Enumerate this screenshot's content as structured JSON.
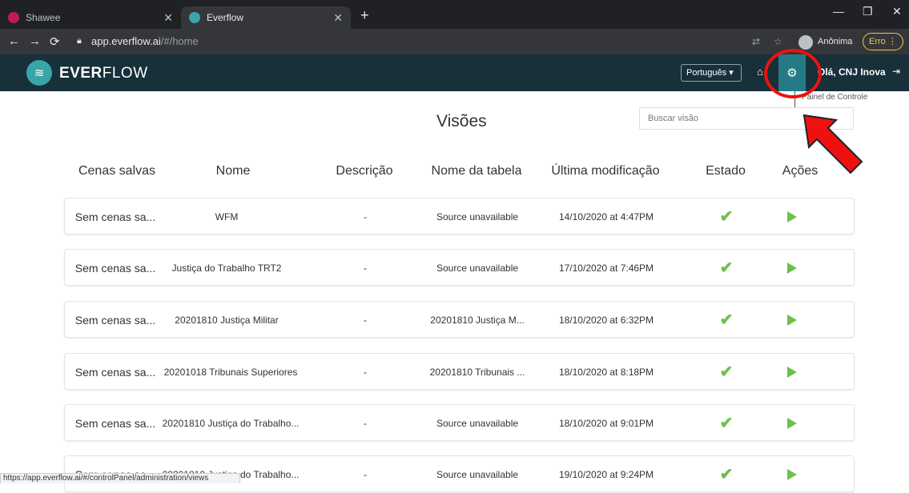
{
  "browser": {
    "tabs": [
      {
        "label": "Shawee",
        "favicon_color": "#c2185b"
      },
      {
        "label": "Everflow",
        "favicon_color": "#39a5a8"
      }
    ],
    "new_tab": "+",
    "address_host": "app.everflow.ai",
    "address_path": "/#/home",
    "profile_label": "Anônima",
    "error_badge": "Erro ⋮",
    "status_url": "https://app.everflow.ai/#/controlPanel/administration/views"
  },
  "app": {
    "brand_strong": "EVER",
    "brand_rest": "FLOW",
    "language": "Português ▾",
    "greeting": "Olá, CNJ Inova",
    "settings_tooltip": "Painel de Controle"
  },
  "page": {
    "title": "Visões",
    "search_placeholder": "Buscar visão"
  },
  "table": {
    "columns": [
      "Cenas salvas",
      "Nome",
      "Descrição",
      "Nome da tabela",
      "Última modificação",
      "Estado",
      "Ações"
    ],
    "rows": [
      {
        "cenas": "Sem cenas sa...",
        "nome": "WFM",
        "descricao": "-",
        "tabela": "Source unavailable",
        "modificacao": "14/10/2020 at 4:47PM"
      },
      {
        "cenas": "Sem cenas sa...",
        "nome": "Justiça do Trabalho TRT2",
        "descricao": "-",
        "tabela": "Source unavailable",
        "modificacao": "17/10/2020 at 7:46PM"
      },
      {
        "cenas": "Sem cenas sa...",
        "nome": "20201810 Justiça Militar",
        "descricao": "-",
        "tabela": "20201810 Justiça M...",
        "modificacao": "18/10/2020 at 6:32PM"
      },
      {
        "cenas": "Sem cenas sa...",
        "nome": "20201018 Tribunais Superiores",
        "descricao": "-",
        "tabela": "20201810 Tribunais ...",
        "modificacao": "18/10/2020 at 8:18PM"
      },
      {
        "cenas": "Sem cenas sa...",
        "nome": "20201810 Justiça do Trabalho...",
        "descricao": "-",
        "tabela": "Source unavailable",
        "modificacao": "18/10/2020 at 9:01PM"
      },
      {
        "cenas": "Sem cenas sa...",
        "nome": "20201810 Justiça do Trabalho...",
        "descricao": "-",
        "tabela": "Source unavailable",
        "modificacao": "19/10/2020 at 9:24PM"
      }
    ]
  },
  "colors": {
    "nav_bg": "#17303a",
    "accent": "#247b86",
    "ok_green": "#6cc24a",
    "annotation_red": "#ee1111"
  }
}
